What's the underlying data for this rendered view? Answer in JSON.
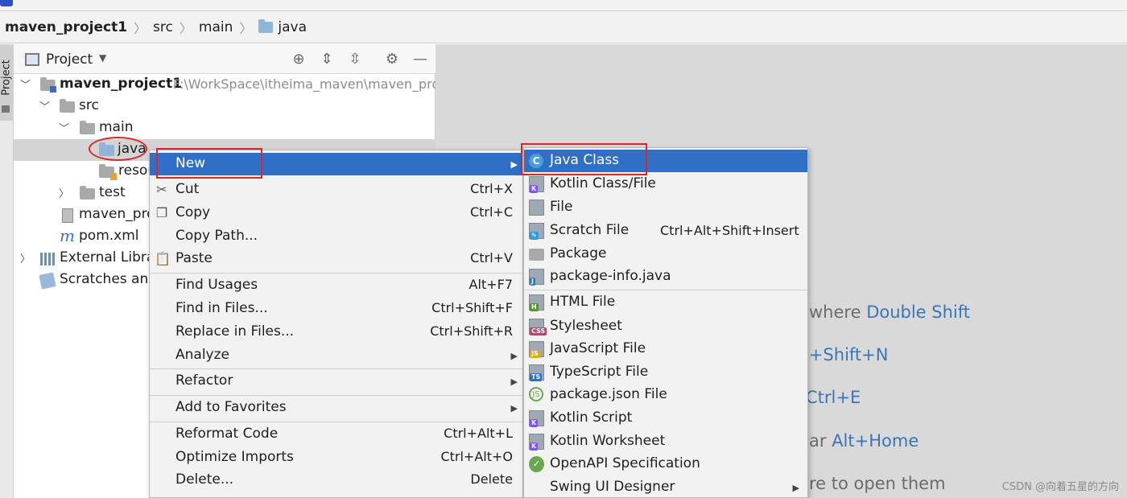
{
  "breadcrumb": {
    "project": "maven_project1",
    "items": [
      "src",
      "main",
      "java"
    ]
  },
  "project_panel": {
    "title": "Project",
    "tree": {
      "root": {
        "label": "maven_project1",
        "path": "F:\\WorkSpace\\itheima_maven\\maven_pro"
      },
      "src": "src",
      "main": "main",
      "java": "java",
      "resources": "resou",
      "test": "test",
      "iml": "maven_pro",
      "pom": "pom.xml",
      "libraries": "External Librar",
      "scratches": "Scratches and"
    }
  },
  "toolstrip": {
    "tab_label": "Project"
  },
  "context_menu": {
    "items": [
      {
        "label": "New",
        "shortcut": "",
        "submenu": true
      },
      {
        "label": "Cut",
        "shortcut": "Ctrl+X"
      },
      {
        "label": "Copy",
        "shortcut": "Ctrl+C"
      },
      {
        "label": "Copy Path...",
        "shortcut": ""
      },
      {
        "label": "Paste",
        "shortcut": "Ctrl+V"
      },
      {
        "label": "Find Usages",
        "shortcut": "Alt+F7"
      },
      {
        "label": "Find in Files...",
        "shortcut": "Ctrl+Shift+F"
      },
      {
        "label": "Replace in Files...",
        "shortcut": "Ctrl+Shift+R"
      },
      {
        "label": "Analyze",
        "shortcut": "",
        "submenu": true
      },
      {
        "label": "Refactor",
        "shortcut": "",
        "submenu": true
      },
      {
        "label": "Add to Favorites",
        "shortcut": "",
        "submenu": true
      },
      {
        "label": "Reformat Code",
        "shortcut": "Ctrl+Alt+L"
      },
      {
        "label": "Optimize Imports",
        "shortcut": "Ctrl+Alt+O"
      },
      {
        "label": "Delete...",
        "shortcut": "Delete"
      }
    ]
  },
  "new_submenu": {
    "items": [
      {
        "label": "Java Class",
        "shortcut": ""
      },
      {
        "label": "Kotlin Class/File",
        "shortcut": ""
      },
      {
        "label": "File",
        "shortcut": ""
      },
      {
        "label": "Scratch File",
        "shortcut": "Ctrl+Alt+Shift+Insert"
      },
      {
        "label": "Package",
        "shortcut": ""
      },
      {
        "label": "package-info.java",
        "shortcut": ""
      },
      {
        "label": "HTML File",
        "shortcut": ""
      },
      {
        "label": "Stylesheet",
        "shortcut": ""
      },
      {
        "label": "JavaScript File",
        "shortcut": ""
      },
      {
        "label": "TypeScript File",
        "shortcut": ""
      },
      {
        "label": "package.json File",
        "shortcut": ""
      },
      {
        "label": "Kotlin Script",
        "shortcut": ""
      },
      {
        "label": "Kotlin Worksheet",
        "shortcut": ""
      },
      {
        "label": "OpenAPI Specification",
        "shortcut": ""
      },
      {
        "label": "Swing UI Designer",
        "shortcut": "",
        "submenu": true
      }
    ]
  },
  "editor_hints": [
    {
      "text": "where ",
      "key": "Double Shift"
    },
    {
      "text": "",
      "key": "l+Shift+N"
    },
    {
      "text": "",
      "key": "Ctrl+E"
    },
    {
      "text": "ar ",
      "key": "Alt+Home"
    },
    {
      "text": "re to open them",
      "key": ""
    }
  ],
  "watermark": "CSDN @向着五星的方向",
  "colors": {
    "selection": "#2f6fc5",
    "annotation_red": "#d8262a",
    "editor_bg": "#d9d9d9",
    "hint_key": "#3a76b7"
  }
}
